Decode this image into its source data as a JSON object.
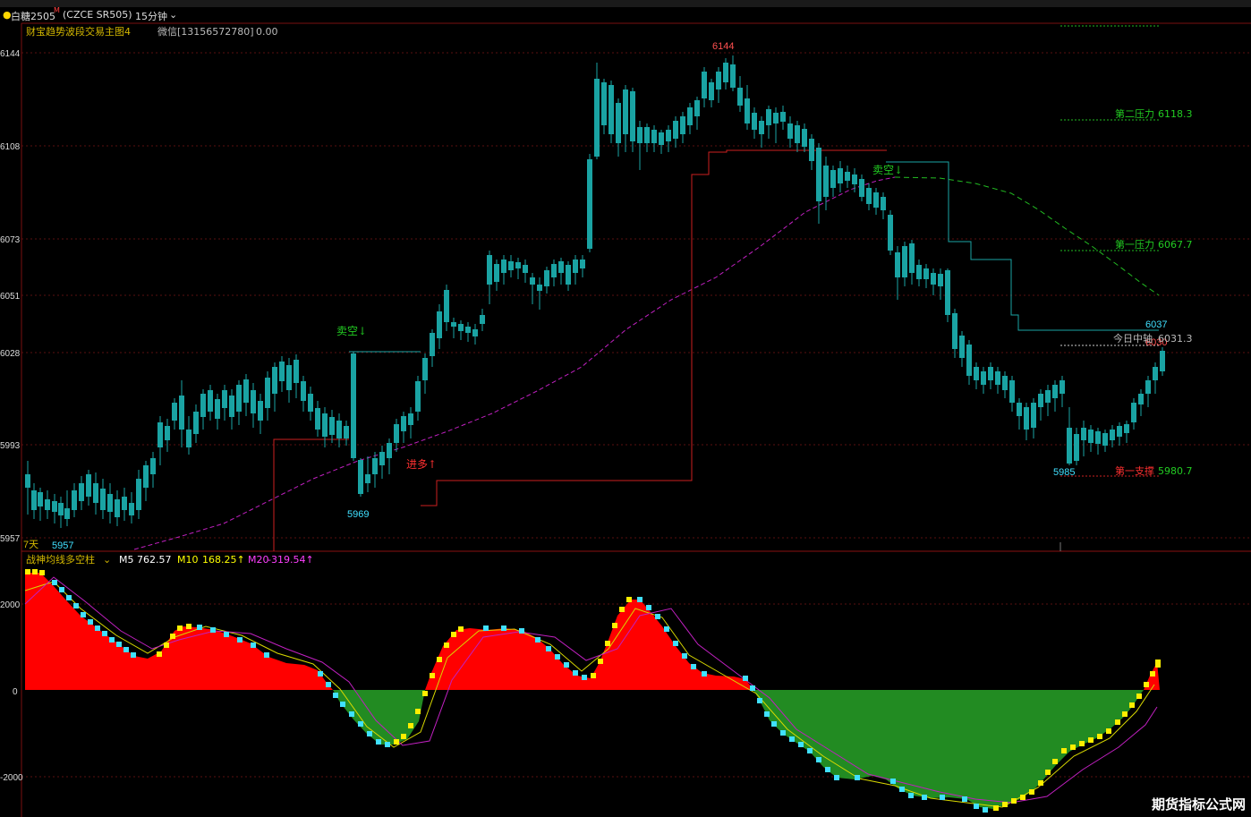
{
  "header": {
    "symbol": "白糖2505",
    "symbol_sup": "M",
    "code": "(CZCE SR505)",
    "period": "15分钟"
  },
  "main_chart": {
    "indicator_name": "财宝趋势波段交易主图4",
    "wechat": "微信[13156572780]",
    "wechat_value": "0.00",
    "y_ticks": [
      "6144",
      "6108",
      "6073",
      "6051",
      "6028",
      "5993",
      "5957"
    ],
    "days_label": "7天",
    "annotations": {
      "high": "6144",
      "low1": "5969",
      "low2": "5957",
      "low3": "5985",
      "last_high": "6037",
      "last_close": "6030",
      "sell1": "卖空↓",
      "sell2": "卖空↓",
      "buy1": "进多↑",
      "res2_label": "第二压力",
      "res2_value": "6118.3",
      "res1_label": "第一压力",
      "res1_value": "6067.7",
      "mid_label": "今日中轴",
      "mid_value": "6031.3",
      "sup1_label": "第一支撑",
      "sup1_value": "5980.7"
    }
  },
  "sub_chart": {
    "indicator_name": "战神均线多空柱",
    "m5_label": "M5",
    "m5_value": "762.57",
    "m10_label": "M10",
    "m10_value": "168.25↑",
    "m20_label": "M20",
    "m20_value": "-319.54↑",
    "y_ticks": [
      "2000",
      "0",
      "-2000"
    ]
  },
  "watermark": "期货指标公式网",
  "colors": {
    "up": "#cc1166",
    "down": "#1aa3a3",
    "grid": "#5a1010",
    "pos_fill": "#ff0000",
    "neg_fill": "#228b22",
    "ma_line": "#c020c0",
    "pressure_line": "#22bb22"
  }
}
